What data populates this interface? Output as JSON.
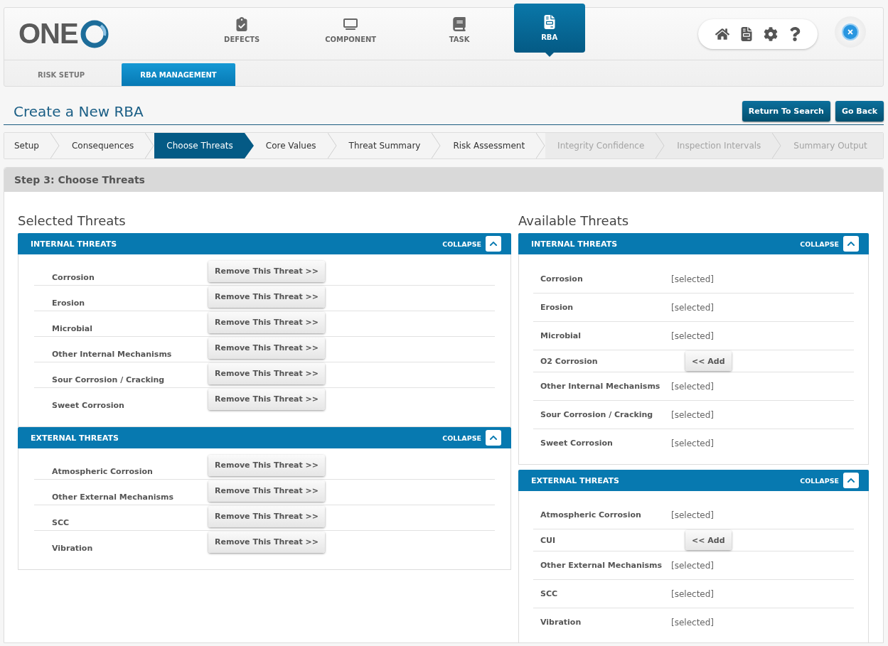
{
  "logo": {
    "text": "ONE"
  },
  "nav": [
    {
      "label": "DEFECTS",
      "selected": false
    },
    {
      "label": "COMPONENT",
      "selected": false
    },
    {
      "label": "TASK",
      "selected": false
    },
    {
      "label": "RBA",
      "selected": true
    }
  ],
  "subtabs": [
    {
      "label": "RISK SETUP",
      "selected": false
    },
    {
      "label": "RBA MANAGEMENT",
      "selected": true
    }
  ],
  "page_title": "Create a New RBA",
  "actions": [
    "Return To Search",
    "Go Back"
  ],
  "steps": [
    {
      "label": "Setup",
      "selected": false,
      "disabled": false
    },
    {
      "label": "Consequences",
      "selected": false,
      "disabled": false
    },
    {
      "label": "Choose Threats",
      "selected": true,
      "disabled": false
    },
    {
      "label": "Core Values",
      "selected": false,
      "disabled": false
    },
    {
      "label": "Threat Summary",
      "selected": false,
      "disabled": false
    },
    {
      "label": "Risk Assessment",
      "selected": false,
      "disabled": false
    },
    {
      "label": "Integrity Confidence",
      "selected": false,
      "disabled": true
    },
    {
      "label": "Inspection Intervals",
      "selected": false,
      "disabled": true
    },
    {
      "label": "Summary Output",
      "selected": false,
      "disabled": true
    }
  ],
  "step_heading": "Step 3: Choose Threats",
  "selected_threats": {
    "title": "Selected Threats",
    "groups": [
      {
        "title": "INTERNAL THREATS",
        "collapse": "COLLAPSE",
        "expanded": true,
        "items": [
          {
            "name": "Corrosion",
            "button": "Remove This Threat >>"
          },
          {
            "name": "Erosion",
            "button": "Remove This Threat >>"
          },
          {
            "name": "Microbial",
            "button": "Remove This Threat >>"
          },
          {
            "name": "Other Internal Mechanisms",
            "button": "Remove This Threat >>"
          },
          {
            "name": "Sour Corrosion / Cracking",
            "button": "Remove This Threat >>"
          },
          {
            "name": "Sweet Corrosion",
            "button": "Remove This Threat >>"
          }
        ]
      },
      {
        "title": "EXTERNAL THREATS",
        "collapse": "COLLAPSE",
        "expanded": true,
        "items": [
          {
            "name": "Atmospheric Corrosion",
            "button": "Remove This Threat >>"
          },
          {
            "name": "Other External Mechanisms",
            "button": "Remove This Threat >>"
          },
          {
            "name": "SCC",
            "button": "Remove This Threat >>"
          },
          {
            "name": "Vibration",
            "button": "Remove This Threat >>"
          }
        ]
      }
    ]
  },
  "available_threats": {
    "title": "Available Threats",
    "groups": [
      {
        "title": "INTERNAL THREATS",
        "collapse": "COLLAPSE",
        "expanded": true,
        "items": [
          {
            "name": "Corrosion",
            "kind": "selected",
            "status": "[selected]"
          },
          {
            "name": "Erosion",
            "kind": "selected",
            "status": "[selected]"
          },
          {
            "name": "Microbial",
            "kind": "selected",
            "status": "[selected]"
          },
          {
            "name": "O2 Corrosion",
            "kind": "add",
            "button": "<< Add"
          },
          {
            "name": "Other Internal Mechanisms",
            "kind": "selected",
            "status": "[selected]"
          },
          {
            "name": "Sour Corrosion / Cracking",
            "kind": "selected",
            "status": "[selected]"
          },
          {
            "name": "Sweet Corrosion",
            "kind": "selected",
            "status": "[selected]"
          }
        ]
      },
      {
        "title": "EXTERNAL THREATS",
        "collapse": "COLLAPSE",
        "expanded": true,
        "items": [
          {
            "name": "Atmospheric Corrosion",
            "kind": "selected",
            "status": "[selected]"
          },
          {
            "name": "CUI",
            "kind": "add",
            "button": "<< Add"
          },
          {
            "name": "Other External Mechanisms",
            "kind": "selected",
            "status": "[selected]"
          },
          {
            "name": "SCC",
            "kind": "selected",
            "status": "[selected]"
          },
          {
            "name": "Vibration",
            "kind": "selected",
            "status": "[selected]"
          }
        ]
      }
    ]
  }
}
